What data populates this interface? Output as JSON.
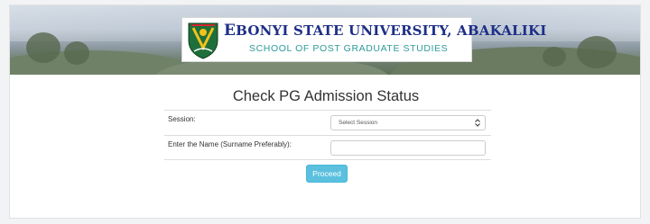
{
  "header": {
    "banner": {
      "title_first_letter": "E",
      "title_rest": "BONYI STATE UNIVERSITY, ABAKALIKI",
      "subtitle": "SCHOOL OF POST GRADUATE STUDIES"
    },
    "logo_icon": "university-crest-icon"
  },
  "main": {
    "heading": "Check PG Admission Status",
    "fields": [
      {
        "label": "Session:",
        "type": "select",
        "selected": "Select Session"
      },
      {
        "label": "Enter the Name (Surname Preferably):",
        "type": "text",
        "value": "",
        "placeholder": ""
      }
    ],
    "proceed_label": "Proceed"
  },
  "colors": {
    "banner_title": "#1e2f86",
    "banner_subtitle": "#2e9a9a",
    "button_bg": "#5bc0de",
    "button_text": "#ffffff"
  }
}
